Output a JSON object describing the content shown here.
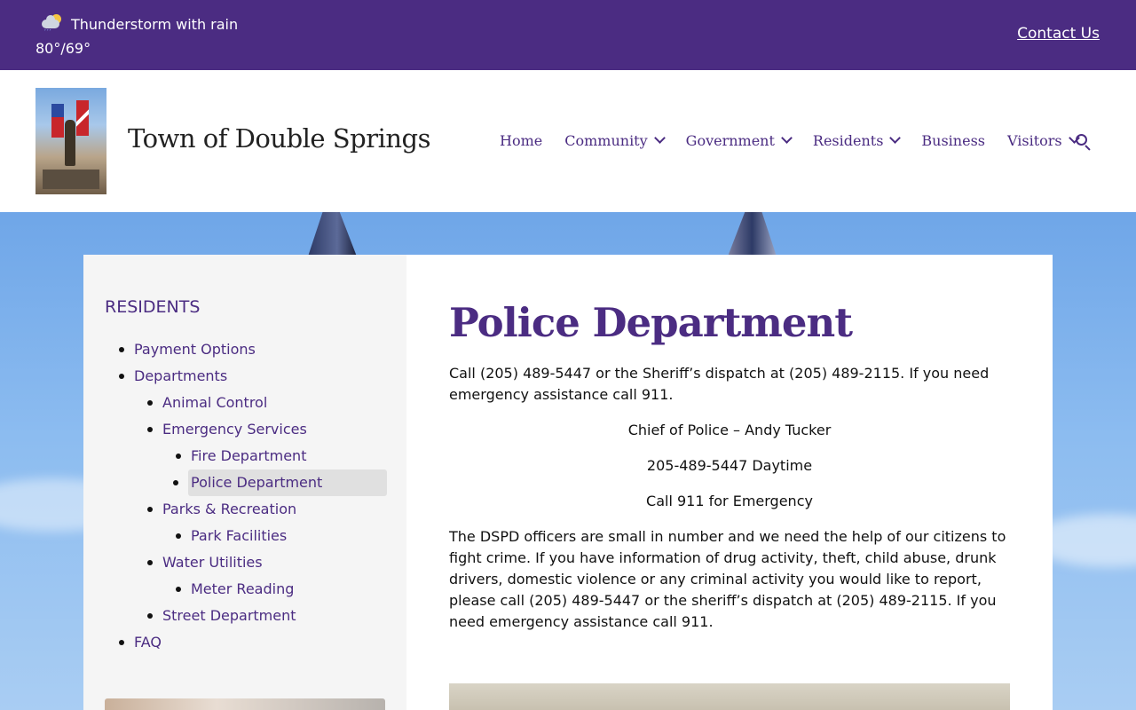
{
  "topbar": {
    "weather_desc": "Thunderstorm with rain",
    "weather_temp": "80°/69°",
    "weather_icon": "thunderstorm-icon",
    "contact": "Contact Us"
  },
  "header": {
    "site_title": "Town of Double Springs",
    "nav": [
      {
        "label": "Home",
        "dropdown": false
      },
      {
        "label": "Community",
        "dropdown": true
      },
      {
        "label": "Government",
        "dropdown": true
      },
      {
        "label": "Residents",
        "dropdown": true
      },
      {
        "label": "Business",
        "dropdown": false
      },
      {
        "label": "Visitors",
        "dropdown": true
      }
    ]
  },
  "sidebar": {
    "heading": "RESIDENTS",
    "items": [
      {
        "label": "Payment Options",
        "level": 1
      },
      {
        "label": "Departments",
        "level": 1
      },
      {
        "label": "Animal Control",
        "level": 2
      },
      {
        "label": "Emergency Services",
        "level": 2
      },
      {
        "label": "Fire Department",
        "level": 3
      },
      {
        "label": "Police Department",
        "level": 3,
        "active": true
      },
      {
        "label": "Parks & Recreation",
        "level": 2
      },
      {
        "label": "Park Facilities",
        "level": 3
      },
      {
        "label": "Water Utilities",
        "level": 2
      },
      {
        "label": "Meter Reading",
        "level": 3
      },
      {
        "label": "Street Department",
        "level": 2
      },
      {
        "label": "FAQ",
        "level": 1
      }
    ]
  },
  "main": {
    "title": "Police Department",
    "intro": "Call (205) 489-5447 or the Sheriff’s dispatch at (205) 489-2115. If you need emergency assistance call 911.",
    "chief": "Chief of Police – Andy Tucker",
    "daytime": "205-489-5447 Daytime",
    "emergency": "Call 911 for Emergency",
    "body": "The DSPD officers are small in number and we need the help of our citizens to fight crime. If you have information of drug activity, theft, child abuse, drunk drivers, domestic violence or any criminal activity you would like to report, please call (205) 489-5447 or the sheriff’s dispatch at (205) 489-2115. If you need emergency assistance call 911."
  },
  "colors": {
    "brand": "#4b2c82",
    "sidebar_bg": "#f5f5f5",
    "active_item_bg": "#e0e0e0"
  }
}
